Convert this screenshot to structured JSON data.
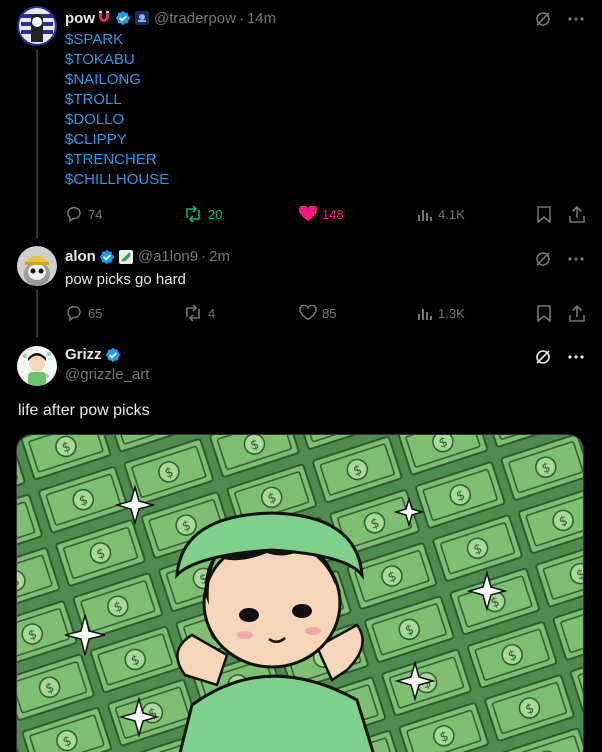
{
  "posts": [
    {
      "name": "pow",
      "handle": "@traderpow",
      "time": "14m",
      "tickers": [
        "$SPARK",
        "$TOKABU",
        "$NAILONG",
        "$TROLL",
        "$DOLLO",
        "$CLIPPY",
        "$TRENCHER",
        "$CHILLHOUSE"
      ],
      "replies": "74",
      "retweets": "20",
      "likes": "148",
      "views": "4.1K"
    },
    {
      "name": "alon",
      "handle": "@a1lon9",
      "time": "2m",
      "text": "pow picks go hard",
      "replies": "65",
      "retweets": "4",
      "likes": "85",
      "views": "1.3K"
    },
    {
      "name": "Grizz",
      "handle": "@grizzle_art",
      "text": "life after pow picks"
    }
  ],
  "separator": "·",
  "colors": {
    "background": "#000000",
    "accent_blue": "#1d9bf0",
    "retweet_green": "#00ba7c",
    "like_pink": "#f91880",
    "muted": "#71767b"
  },
  "icons": [
    "verified-badge-icon",
    "grok-icon",
    "more-icon",
    "reply-icon",
    "retweet-icon",
    "heart-icon",
    "views-icon",
    "bookmark-icon",
    "share-icon"
  ]
}
